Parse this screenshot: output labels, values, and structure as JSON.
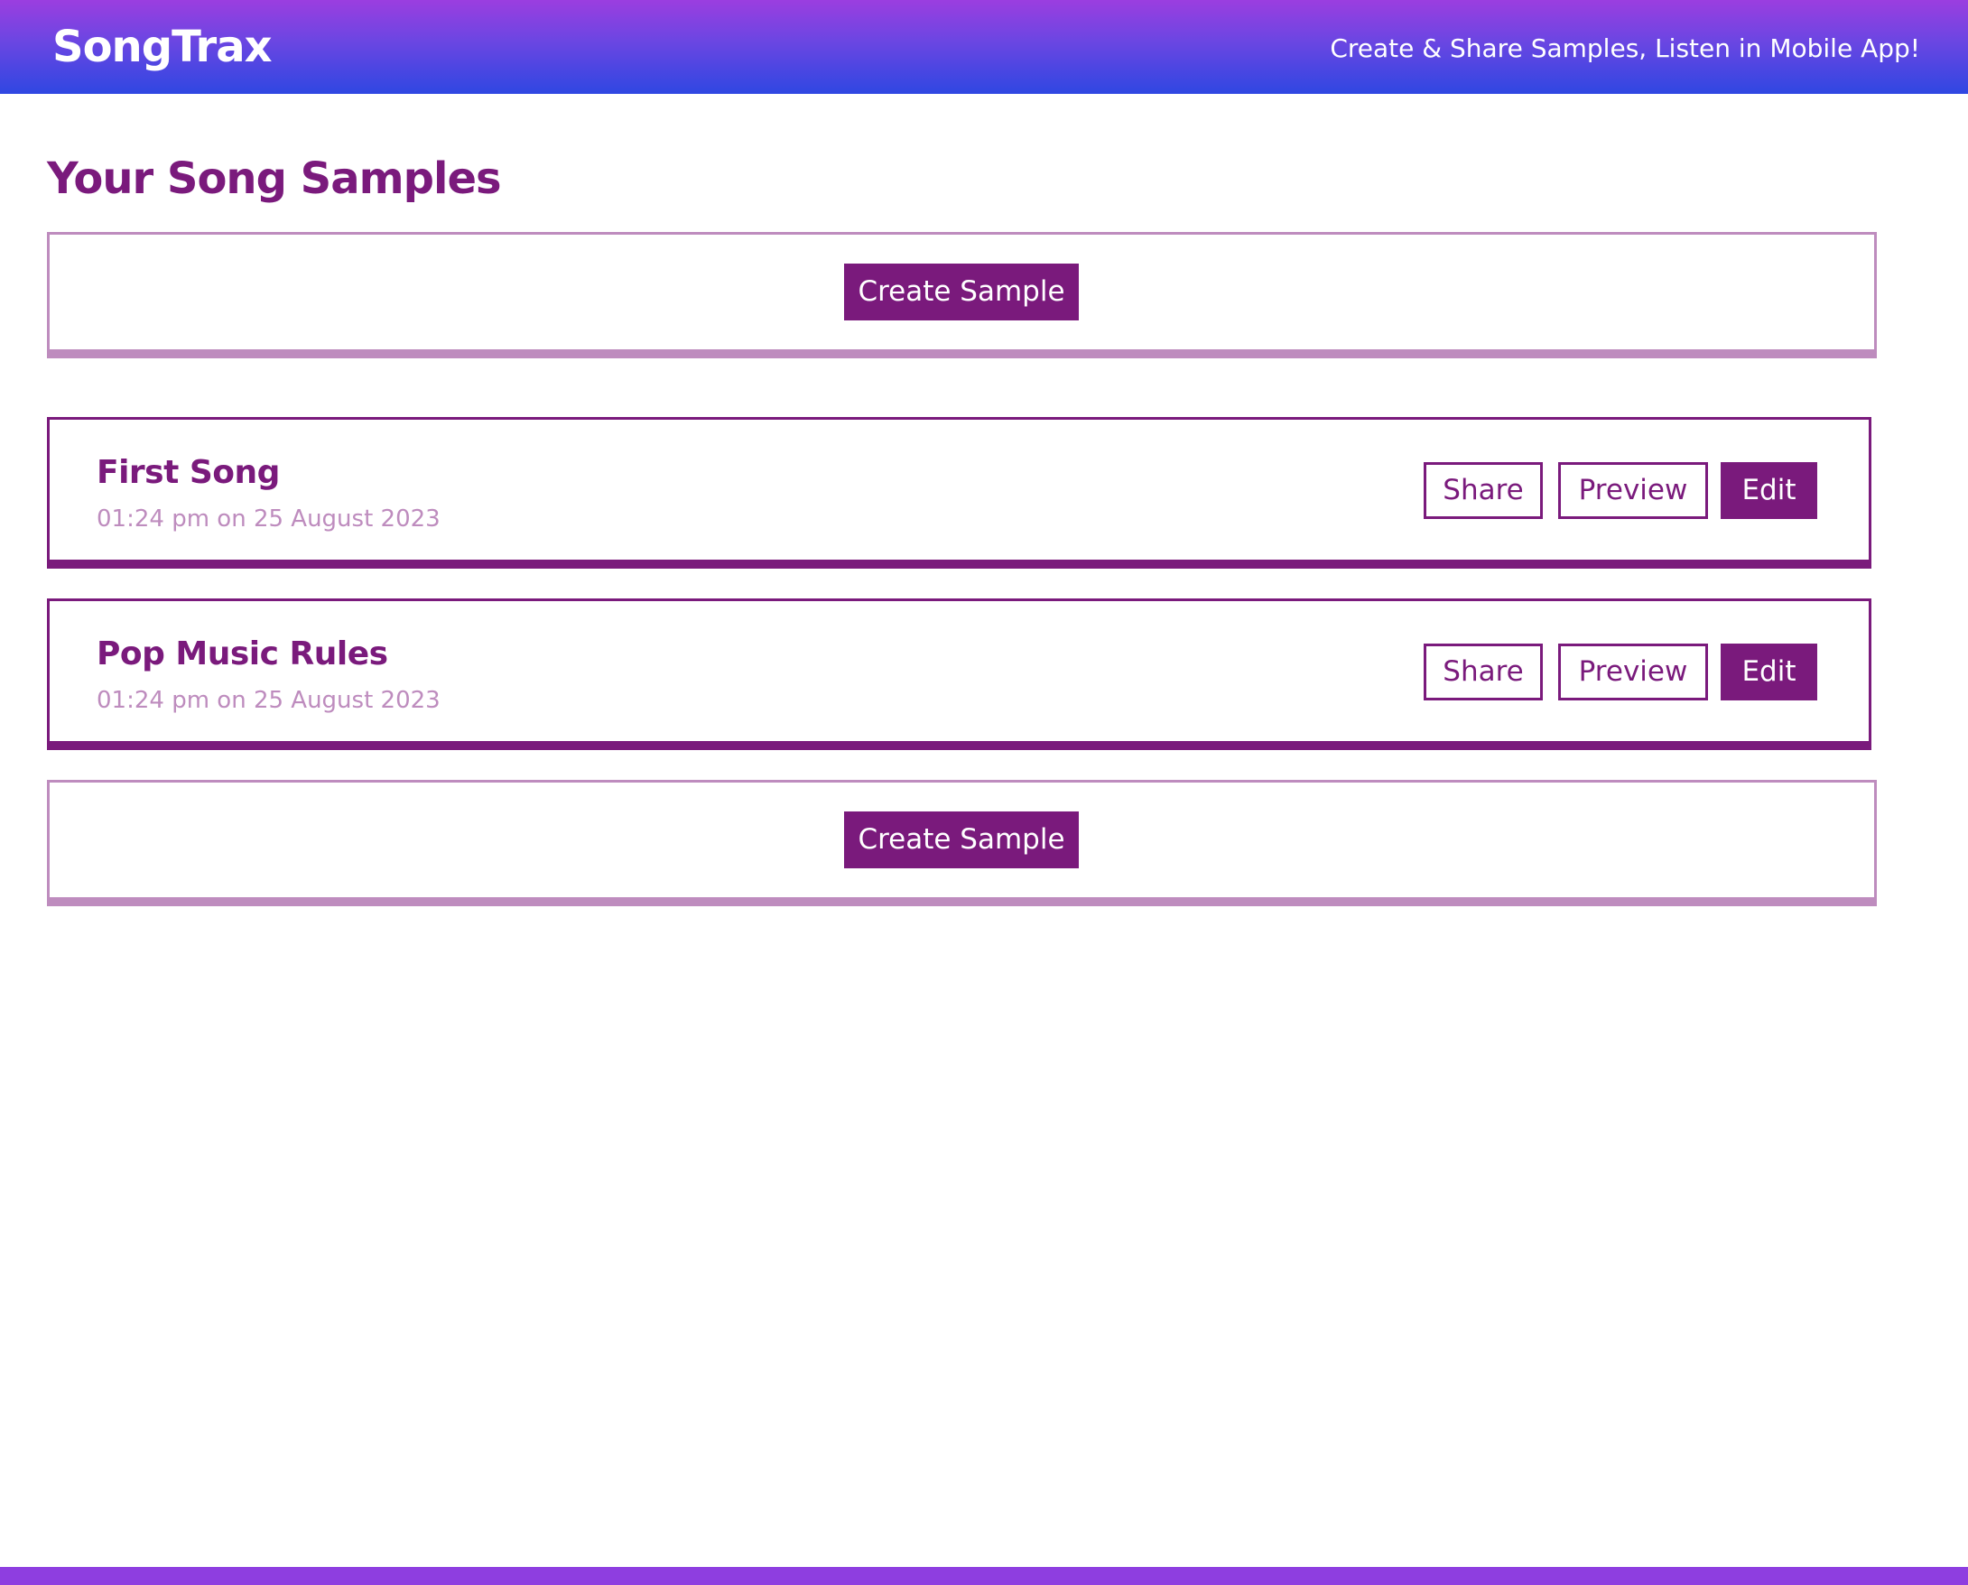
{
  "header": {
    "logo": "SongTrax",
    "tagline": "Create & Share Samples, Listen in Mobile App!"
  },
  "page": {
    "title": "Your Song Samples"
  },
  "create_label": "Create Sample",
  "samples": [
    {
      "title": "First Song",
      "timestamp": "01:24 pm on 25 August 2023",
      "share_label": "Share",
      "preview_label": "Preview",
      "edit_label": "Edit"
    },
    {
      "title": "Pop Music Rules",
      "timestamp": "01:24 pm on 25 August 2023",
      "share_label": "Share",
      "preview_label": "Preview",
      "edit_label": "Edit"
    }
  ],
  "colors": {
    "accent": "#7a1a7c",
    "muted": "#be8cbe",
    "header_gradient_top": "#9b3ee0",
    "header_gradient_bottom": "#2f47e2",
    "footer": "#8e3ee0"
  }
}
